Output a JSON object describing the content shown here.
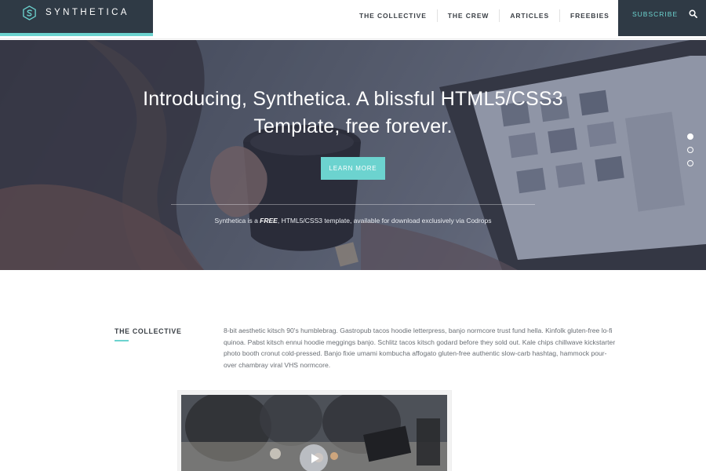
{
  "brand": {
    "name": "SYNTHETICA",
    "logo_icon": "hexagon-s-logo-icon"
  },
  "nav": {
    "items": [
      {
        "label": "THE COLLECTIVE"
      },
      {
        "label": "THE CREW"
      },
      {
        "label": "ARTICLES"
      },
      {
        "label": "FREEBIES"
      }
    ]
  },
  "actions": {
    "subscribe_label": "SUBSCRIBE",
    "search_icon": "search-icon"
  },
  "hero": {
    "title_line1": "Introducing, Synthetica. A blissful HTML5/CSS3",
    "title_line2": "Template, free forever.",
    "button_label": "LEARN MORE",
    "caption_before": "Synthetica is a ",
    "caption_emphasis": "FREE",
    "caption_after": ", HTML5/CSS3 template, available for download exclusively via Codrops",
    "slides": {
      "count": 3,
      "active": 1
    }
  },
  "collective": {
    "heading": "THE COLLECTIVE",
    "body": "8-bit aesthetic kitsch 90's humblebrag. Gastropub tacos hoodie letterpress, banjo normcore trust fund hella. Kinfolk gluten-free lo-fi quinoa. Pabst kitsch ennui hoodie meggings banjo. Schlitz tacos kitsch godard before they sold out. Kale chips chillwave kickstarter photo booth cronut cold-pressed. Banjo fixie umami kombucha affogato gluten-free authentic slow-carb hashtag, hammock pour-over chambray viral VHS normcore."
  },
  "video": {
    "play_icon": "play-icon"
  },
  "colors": {
    "accent": "#6cd3cf",
    "dark": "#2f3a45",
    "text": "#6a6f75"
  }
}
